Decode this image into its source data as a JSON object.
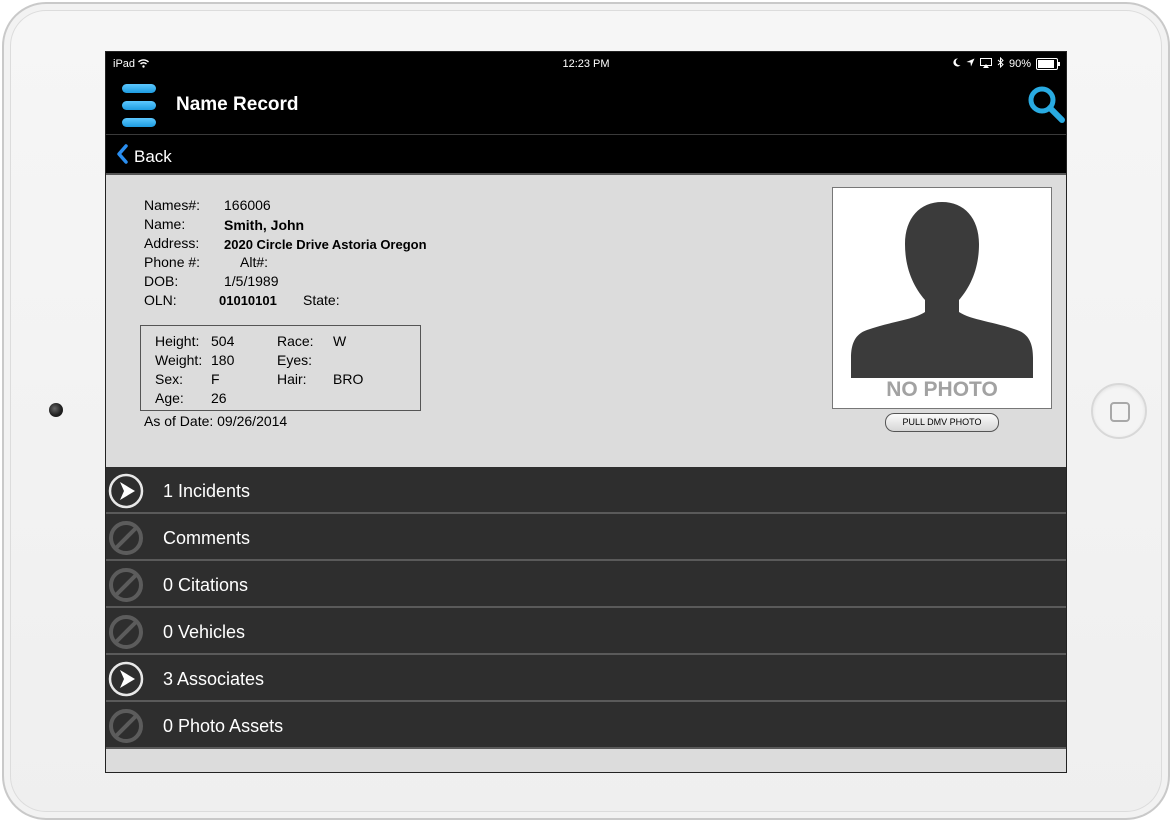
{
  "status_bar": {
    "device": "iPad",
    "time": "12:23 PM",
    "battery": "90%"
  },
  "nav": {
    "title": "Name Record",
    "menu_icon": "hamburger-menu-icon",
    "search_icon": "search-icon",
    "accent_color": "#29abe2"
  },
  "back": {
    "label": "Back"
  },
  "record": {
    "names_label": "Names#:",
    "names_value": "166006",
    "name_label": "Name:",
    "name_value": "Smith, John",
    "address_label": "Address:",
    "address_value": "2020 Circle Drive Astoria Oregon",
    "phone_label": "Phone #:",
    "alt_label": "Alt#:",
    "dob_label": "DOB:",
    "dob_value": "1/5/1989",
    "oln_label": "OLN:",
    "oln_value": "01010101",
    "state_label": "State:"
  },
  "physical": {
    "height_label": "Height:",
    "height_value": "504",
    "weight_label": "Weight:",
    "weight_value": "180",
    "sex_label": "Sex:",
    "sex_value": "F",
    "age_label": "Age:",
    "age_value": "26",
    "race_label": "Race:",
    "race_value": "W",
    "eyes_label": "Eyes:",
    "hair_label": "Hair:",
    "hair_value": "BRO"
  },
  "as_of": "As of Date: 09/26/2014",
  "photo": {
    "placeholder_text": "NO PHOTO",
    "button_label": "PULL DMV PHOTO"
  },
  "sections": [
    {
      "label": "1 Incidents",
      "enabled": true
    },
    {
      "label": "Comments",
      "enabled": false
    },
    {
      "label": "0 Citations",
      "enabled": false
    },
    {
      "label": "0 Vehicles",
      "enabled": false
    },
    {
      "label": "3 Associates",
      "enabled": true
    },
    {
      "label": "0 Photo Assets",
      "enabled": false
    }
  ]
}
